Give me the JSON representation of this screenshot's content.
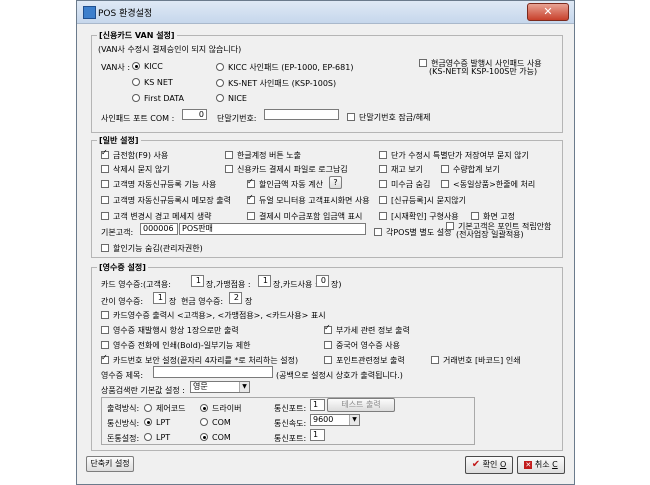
{
  "window": {
    "title": "POS 환경설정",
    "close_glyph": "✕"
  },
  "van": {
    "title": "[신용카드 VAN 설정]",
    "notice": "(VAN사 수정시 결제승인이 되지 않습니다)",
    "vansa_label": "VAN사 :",
    "opt_kicc": "KICC",
    "opt_kicc_pad": "KICC 사인패드 (EP-1000, EP-681)",
    "opt_ksnet": "KS NET",
    "opt_ksnet_pad": "KS-NET 사인패드 (KSP-100S)",
    "opt_firstdata": "First DATA",
    "opt_nice": "NICE",
    "cash_receipt_line1": "현금영수증 발행시 사인패드 사용",
    "cash_receipt_line2": "(KS-NET의 KSP-100S만 가능)",
    "signpad_port_label": "사인패드 포트 COM :",
    "signpad_port_value": "0",
    "terminal_no_label": "단말기번호:",
    "terminal_no_value": "",
    "terminal_lock_label": "단말기번호 잠금/해제"
  },
  "general": {
    "title": "[일반 설정]",
    "c_f9": "금전함(F9) 사용",
    "c_korean_btn": "한글계정 버튼 노출",
    "c_price_modify": "단가 수정시 특별단가 저장여부 묻지 않기",
    "c_delete_noask": "삭제시 묻지 않기",
    "c_card_log": "신용카드 결제시 파일로 로그남김",
    "c_stock_view": "재고 보기",
    "c_qty_sum": "수량합계 보기",
    "c_cust_auto": "고객명 자동신규등록 기능 사용",
    "c_discount_auto": "할인금액 자동 계산",
    "help_btn": "?",
    "c_unpaid_hide": "미수금 숨김",
    "c_same_item": "<동일상품>한줄에 처리",
    "c_cust_memo": "고객명 자동신규등록시 메모장 출력",
    "c_dual_monitor": "듀얼 모니터용 고객표시화면 사용",
    "c_new_reg": "[신규등록]시 묻지않기",
    "c_cust_change": "고객 변경시 경고 메세지 생략",
    "c_unpaid_display": "결제시 미수금포함 입금액 표시",
    "c_market_price": "[시재확인] 구형사용",
    "c_screen_fix": "화면 고정",
    "default_cust_label": "기본고객:",
    "default_cust_code": "000006",
    "default_cust_name": "POS판매",
    "c_pos_separate": "각POS별 별도 설정",
    "c_point_line1": "기본고객은 포인트 적립안함",
    "c_point_line2": "(전사업장 일괄적용)",
    "c_discount_hide": "할인기능 숨김(관리자권한)"
  },
  "receipt": {
    "title": "[영수증 설정]",
    "card_receipt_pre": "카드 영수증:(고객용:",
    "card_receipt_cust": "1",
    "card_receipt_mid": "장,가맹점용 :",
    "card_receipt_merchant": "1",
    "card_receipt_mid2": "장,카드사용 :",
    "card_receipt_card": "0",
    "card_receipt_post": "장)",
    "simple_label": "간이 영수증:",
    "simple_value": "1",
    "simple_unit": "장",
    "cash_label": "현금 영수증:",
    "cash_value": "2",
    "cash_unit": "장",
    "c_card_types": "카드영수증 출력시 <고객용>, <가맹점용>, <카드사용> 표시",
    "c_reissue_one": "영수증 재발행시 항상 1장으로만 출력",
    "c_vat_print": "부가세 관련 정보 출력",
    "c_bold_limit": "영수증 전화에 인쇄(Bold)-일부기능 제한",
    "c_chinese": "중국어 영수증 사용",
    "c_card_mask": "카드번호 보안 설정(끝자리 4자리를 *로 처리하는 설정)",
    "c_point_print": "포인트관련정보 출력",
    "c_barcode": "거래번호 [바코드] 인쇄",
    "title_label": "영수증 제목:",
    "title_value": "",
    "title_hint": "(공백으로 설정시 상호가 출력됩니다.)",
    "search_label": "상품검색란 기본값 설정 :",
    "search_value": "영문",
    "print_method_label": "출력방식:",
    "pm_control": "제어코드",
    "pm_driver": "드라이버",
    "comm_port_label": "통신포트:",
    "comm_port_value": "1",
    "test_print_btn": "테스트 출력",
    "comm_method_label": "통신방식:",
    "cm_lpt": "LPT",
    "cm_com": "COM",
    "comm_speed_label": "통신속도:",
    "comm_speed_value": "9600",
    "drawer_label": "돈통설정:",
    "dr_lpt": "LPT",
    "dr_com": "COM",
    "drawer_port_label": "통신포트:",
    "drawer_port_value": "1"
  },
  "footer": {
    "shortcut_btn": "단축키 설정",
    "ok_btn": "확인",
    "ok_key": "O",
    "cancel_btn": "취소",
    "cancel_key": "C"
  }
}
